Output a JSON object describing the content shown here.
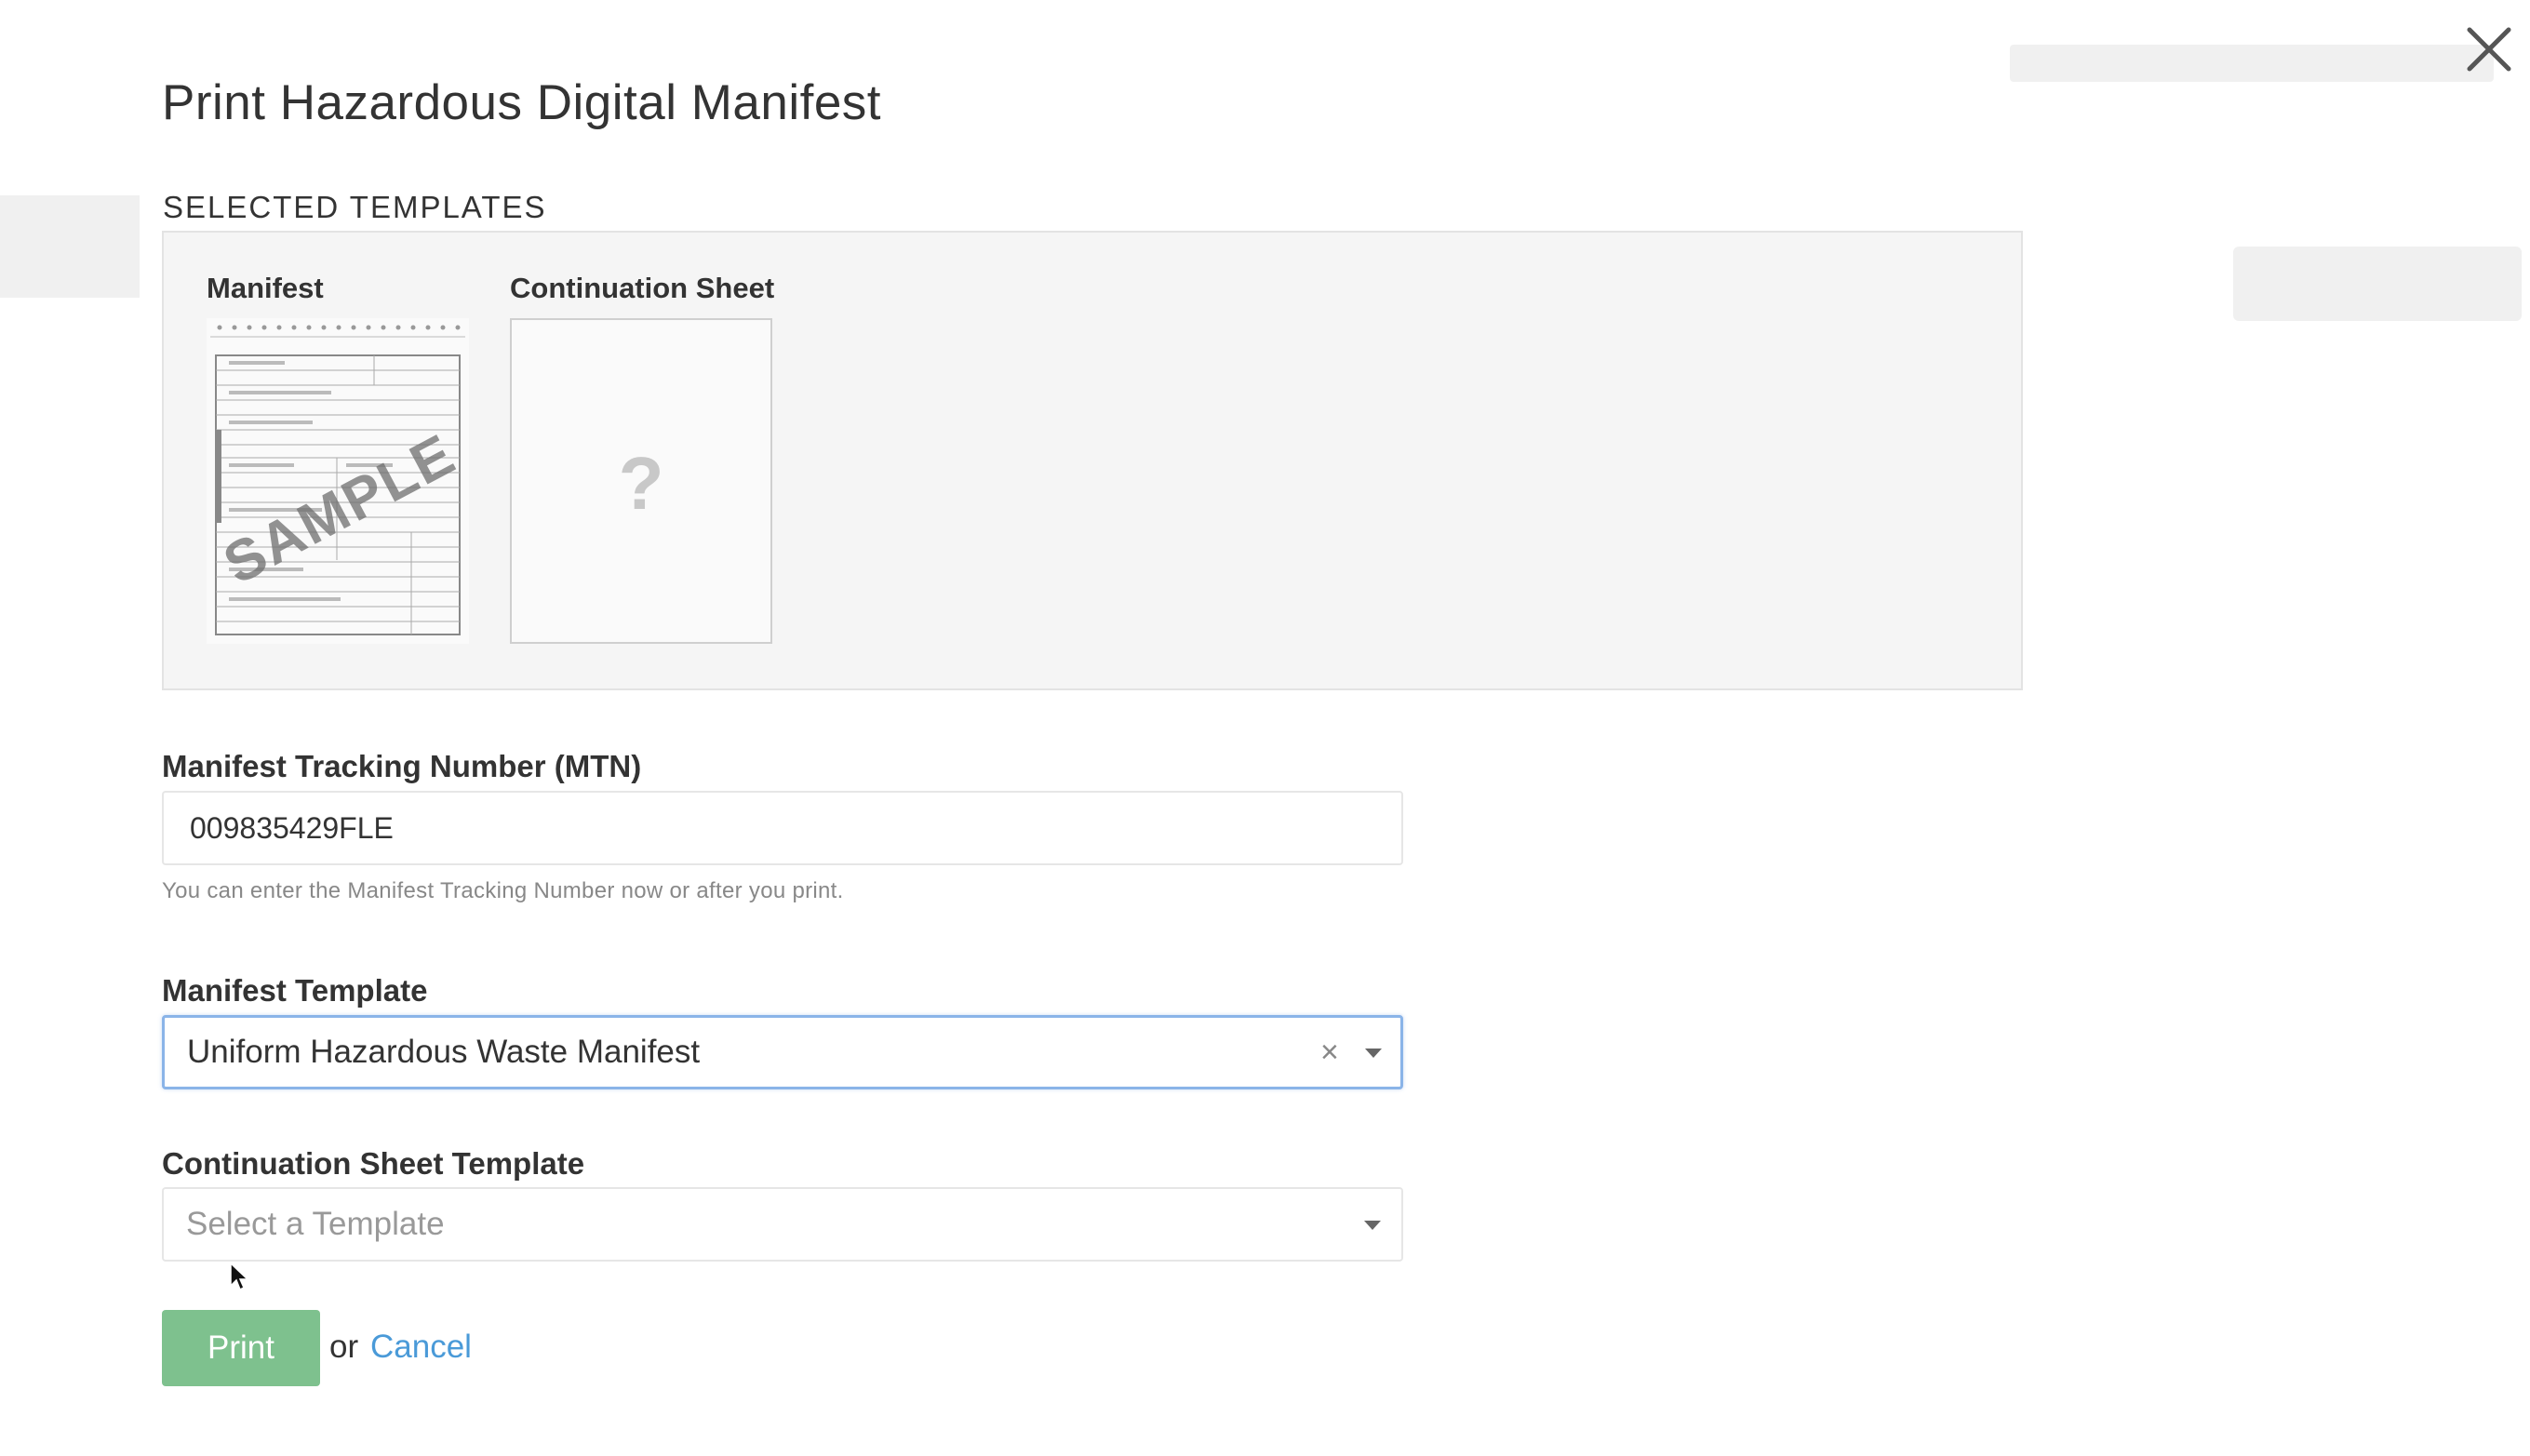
{
  "dialog": {
    "title": "Print Hazardous Digital Manifest",
    "selected_templates_heading": "SELECTED TEMPLATES",
    "templates": [
      {
        "label": "Manifest",
        "preview_watermark": "SAMPLE"
      },
      {
        "label": "Continuation Sheet",
        "preview_placeholder": "?"
      }
    ],
    "mtn": {
      "label": "Manifest Tracking Number (MTN)",
      "value": "009835429FLE",
      "help": "You can enter the Manifest Tracking Number now or after you print."
    },
    "manifest_template": {
      "label": "Manifest Template",
      "selected": "Uniform Hazardous Waste Manifest",
      "clear_glyph": "×"
    },
    "continuation_template": {
      "label": "Continuation Sheet Template",
      "placeholder": "Select a Template"
    },
    "actions": {
      "print_label": "Print",
      "or_text": "or",
      "cancel_label": "Cancel"
    }
  },
  "colors": {
    "print_button": "#7ec18e",
    "link": "#4a9ad8",
    "focus_border": "#8ab4e8",
    "panel_bg": "#f5f5f5"
  },
  "icons": {
    "close": "close-icon",
    "caret": "chevron-down-icon",
    "clear": "clear-icon",
    "cursor": "mouse-pointer-icon"
  }
}
